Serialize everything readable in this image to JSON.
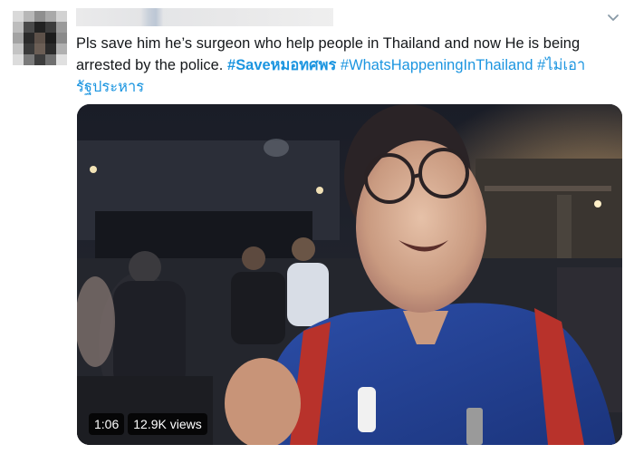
{
  "tweet": {
    "text": "Pls save him he’s surgeon who help people in Thailand and now He is being arrested by the police.",
    "hashtags": [
      "#Saveหมอทศพร",
      "#WhatsHappeningInThailand",
      "#ไม่เอารัฐประหาร"
    ],
    "hashtag_color": "#1b95e0",
    "text_color": "#14171a"
  },
  "menu": {
    "icon": "chevron-down-icon"
  },
  "video": {
    "duration": "1:06",
    "views": "12.9K views",
    "description": "",
    "badge_background": "#000000"
  }
}
